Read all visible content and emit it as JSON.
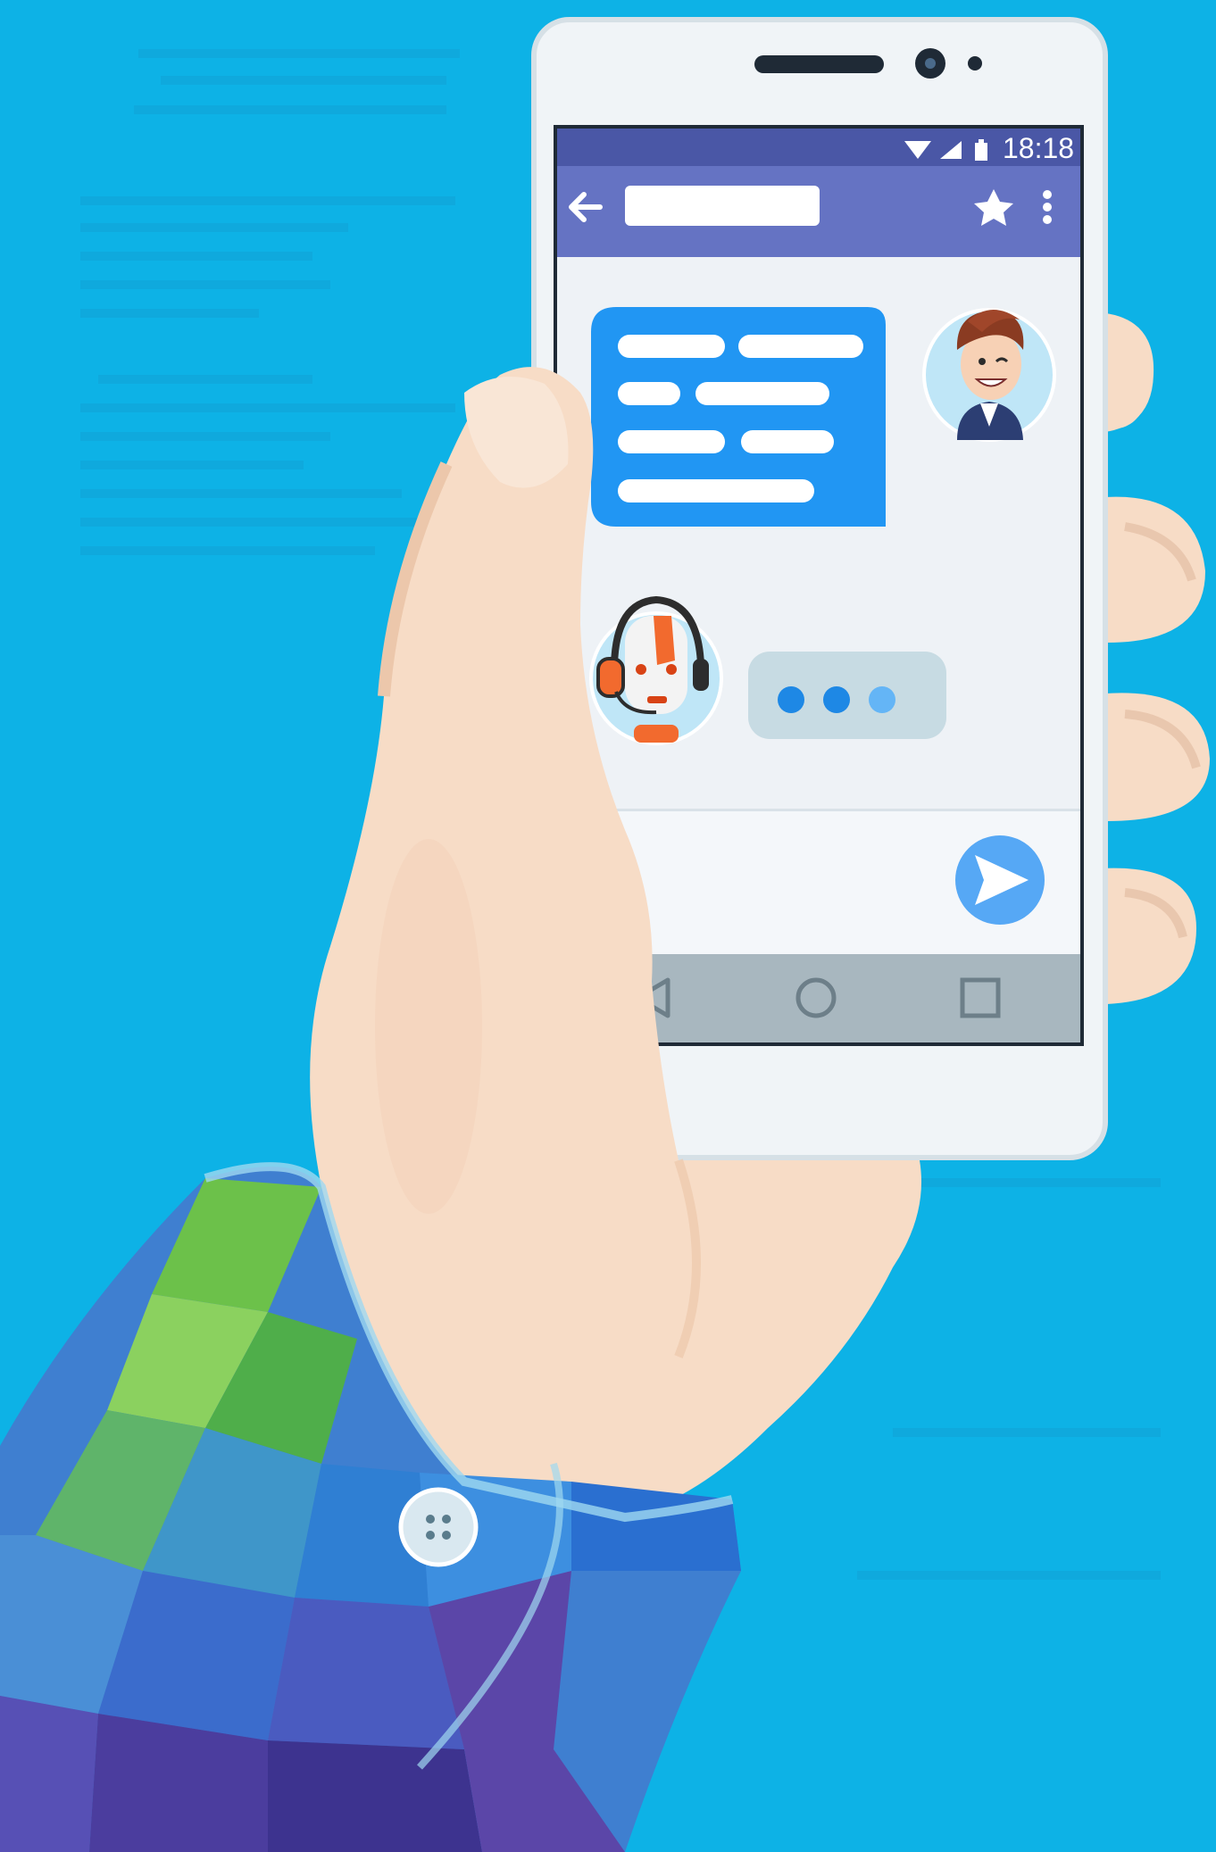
{
  "colors": {
    "background": "#0db2e6",
    "phone_body": "#f0f4f7",
    "status_bar": "#4a57a6",
    "app_bar": "#6573c3",
    "chat_area": "#eef2f6",
    "user_bubble": "#2196f3",
    "typing_bubble": "#c7dbe3",
    "typing_dot_active": "#1e88e5",
    "typing_dot_fading": "#64b5f6",
    "send_button": "#56a8f5",
    "nav_bar": "#a8b7bf",
    "skin": "#f7dcc6",
    "sleeve_green": "#6cc14a",
    "sleeve_blue": "#3f7fd0",
    "sleeve_purple": "#5b46a8"
  },
  "status_bar": {
    "time": "18:18",
    "icons": [
      "wifi-icon",
      "signal-icon",
      "battery-icon"
    ]
  },
  "app_bar": {
    "icons": [
      "back-arrow-icon",
      "star-icon",
      "more-vertical-icon"
    ]
  },
  "chat": {
    "messages": [
      {
        "sender": "user",
        "avatar": "user-avatar-icon",
        "bubble": "text-placeholder-lines"
      },
      {
        "sender": "bot",
        "avatar": "robot-support-avatar-icon",
        "bubble": "typing-indicator"
      }
    ]
  },
  "composer": {
    "icons": [
      "send-icon"
    ]
  },
  "nav_bar": {
    "icons": [
      "nav-back-icon",
      "nav-home-icon",
      "nav-recents-icon"
    ]
  }
}
